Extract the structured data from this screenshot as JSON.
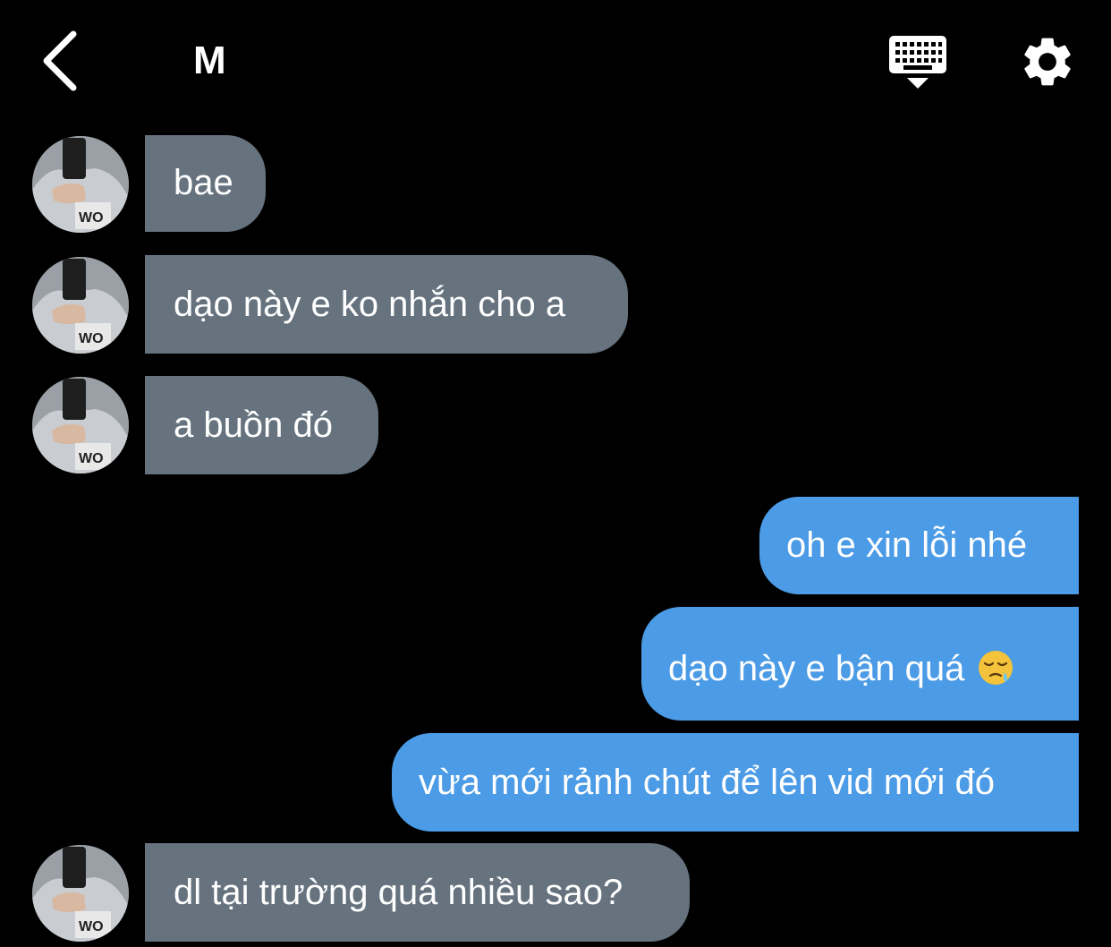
{
  "header": {
    "title": "M",
    "back_icon": "chevron-left-icon",
    "keyboard_icon": "keyboard-icon",
    "settings_icon": "gear-icon"
  },
  "messages": [
    {
      "direction": "in",
      "text": "bae"
    },
    {
      "direction": "in",
      "text": "dạo này e ko nhắn cho a"
    },
    {
      "direction": "in",
      "text": "a buồn đó"
    },
    {
      "direction": "out",
      "text": "oh e xin lỗi nhé"
    },
    {
      "direction": "out",
      "text": "dạo này e bận quá",
      "emoji": "sleepy-face-emoji"
    },
    {
      "direction": "out",
      "text": "vừa mới rảnh chút để lên vid mới đó"
    },
    {
      "direction": "in",
      "text": "dl tại trường quá nhiều sao?"
    }
  ],
  "colors": {
    "background": "#000000",
    "incoming_bubble": "#66737f",
    "outgoing_bubble": "#4b9be6",
    "text": "#ffffff"
  }
}
